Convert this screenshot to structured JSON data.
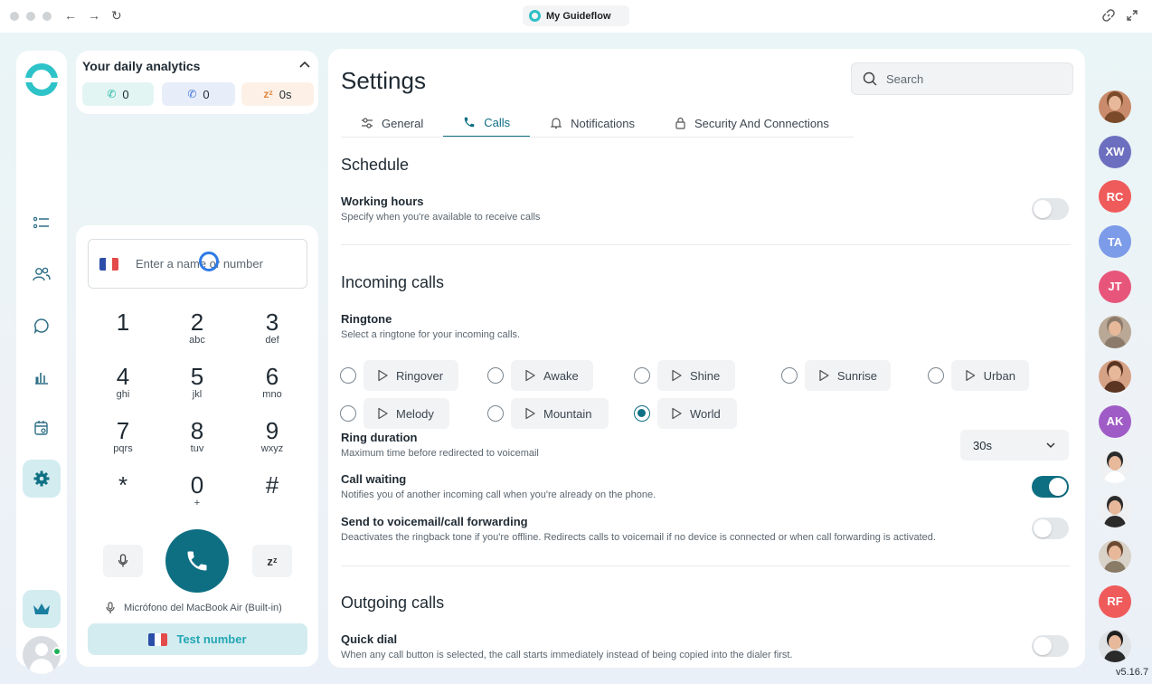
{
  "browser": {
    "tab_title": "My Guideflow",
    "nav_back": "←",
    "nav_forward": "→",
    "nav_reload": "↻",
    "link_icon": "link-icon",
    "expand_icon": "expand-icon"
  },
  "analytics": {
    "title": "Your daily analytics",
    "incoming": "0",
    "outgoing": "0",
    "idle": "0s",
    "idle_icon": "zᶻ",
    "colors": {
      "incoming_bg": "#e3f5f3",
      "outgoing_bg": "#e8eef9",
      "idle_bg": "#fdf1e7",
      "incoming_icon": "#1fb5a3",
      "outgoing_icon": "#3b6fd6",
      "idle_icon": "#e0863f"
    }
  },
  "dialer": {
    "placeholder": "Enter a name or number",
    "keys": [
      {
        "digit": "1",
        "letters": ""
      },
      {
        "digit": "2",
        "letters": "abc"
      },
      {
        "digit": "3",
        "letters": "def"
      },
      {
        "digit": "4",
        "letters": "ghi"
      },
      {
        "digit": "5",
        "letters": "jkl"
      },
      {
        "digit": "6",
        "letters": "mno"
      },
      {
        "digit": "7",
        "letters": "pqrs"
      },
      {
        "digit": "8",
        "letters": "tuv"
      },
      {
        "digit": "9",
        "letters": "wxyz"
      },
      {
        "digit": "*",
        "letters": ""
      },
      {
        "digit": "0",
        "letters": "+"
      },
      {
        "digit": "#",
        "letters": ""
      }
    ],
    "snooze_label": "zᶻ",
    "microphone": "Micrófono del MacBook Air (Built-in)",
    "test_button": "Test number"
  },
  "settings": {
    "title": "Settings",
    "search_placeholder": "Search",
    "tabs": [
      {
        "label": "General",
        "icon": "sliders-icon",
        "active": false
      },
      {
        "label": "Calls",
        "icon": "phone-icon",
        "active": true
      },
      {
        "label": "Notifications",
        "icon": "bell-icon",
        "active": false
      },
      {
        "label": "Security And Connections",
        "icon": "lock-icon",
        "active": false
      }
    ],
    "schedule": {
      "heading": "Schedule",
      "working_hours": {
        "label": "Working hours",
        "description": "Specify when you're available to receive calls",
        "enabled": false
      }
    },
    "incoming": {
      "heading": "Incoming calls",
      "ringtone_label": "Ringtone",
      "ringtone_description": "Select a ringtone for your incoming calls.",
      "ringtones": [
        "Ringover",
        "Awake",
        "Shine",
        "Sunrise",
        "Urban",
        "Melody",
        "Mountain",
        "World"
      ],
      "selected_ringtone": "World",
      "ring_duration": {
        "label": "Ring duration",
        "description": "Maximum time before redirected to voicemail",
        "value": "30s"
      },
      "call_waiting": {
        "label": "Call waiting",
        "description": "Notifies you of another incoming call when you're already on the phone.",
        "enabled": true
      },
      "voicemail": {
        "label": "Send to voicemail/call forwarding",
        "description": "Deactivates the ringback tone if you're offline. Redirects calls to voicemail if no device is connected or when call forwarding is activated.",
        "enabled": false
      }
    },
    "outgoing": {
      "heading": "Outgoing calls",
      "quick_dial": {
        "label": "Quick dial",
        "description": "When any call button is selected, the call starts immediately instead of being copied into the dialer first.",
        "enabled": false
      }
    }
  },
  "contacts": [
    {
      "initials": "",
      "color": "#c98b6b",
      "hair": "#7a4a2a"
    },
    {
      "initials": "XW",
      "color": "#6c6fbf"
    },
    {
      "initials": "RC",
      "color": "#ef5b5b"
    },
    {
      "initials": "TA",
      "color": "#7c9be8"
    },
    {
      "initials": "JT",
      "color": "#e8557a"
    },
    {
      "initials": "",
      "color": "#b9a895",
      "hair": "#8c7b6a"
    },
    {
      "initials": "",
      "color": "#d6a286",
      "hair": "#5b3422"
    },
    {
      "initials": "AK",
      "color": "#a05cc6"
    },
    {
      "initials": "",
      "color": "#eef0f2",
      "hair": "#2b2b2b",
      "body": "#ffffff"
    },
    {
      "initials": "",
      "color": "#eef0f2",
      "hair": "#2b2b2b",
      "body": "#2b2b2b"
    },
    {
      "initials": "",
      "color": "#d9d2c8",
      "hair": "#6b4a33",
      "body": "#8a7b66"
    },
    {
      "initials": "RF",
      "color": "#ef5b5b"
    },
    {
      "initials": "",
      "color": "#e0e3e6",
      "hair": "#1f1f1f",
      "body": "#2a2a2a"
    }
  ],
  "version": "v5.16.7",
  "colors": {
    "primary": "#0e6f83",
    "accent": "#2ec3c9"
  }
}
